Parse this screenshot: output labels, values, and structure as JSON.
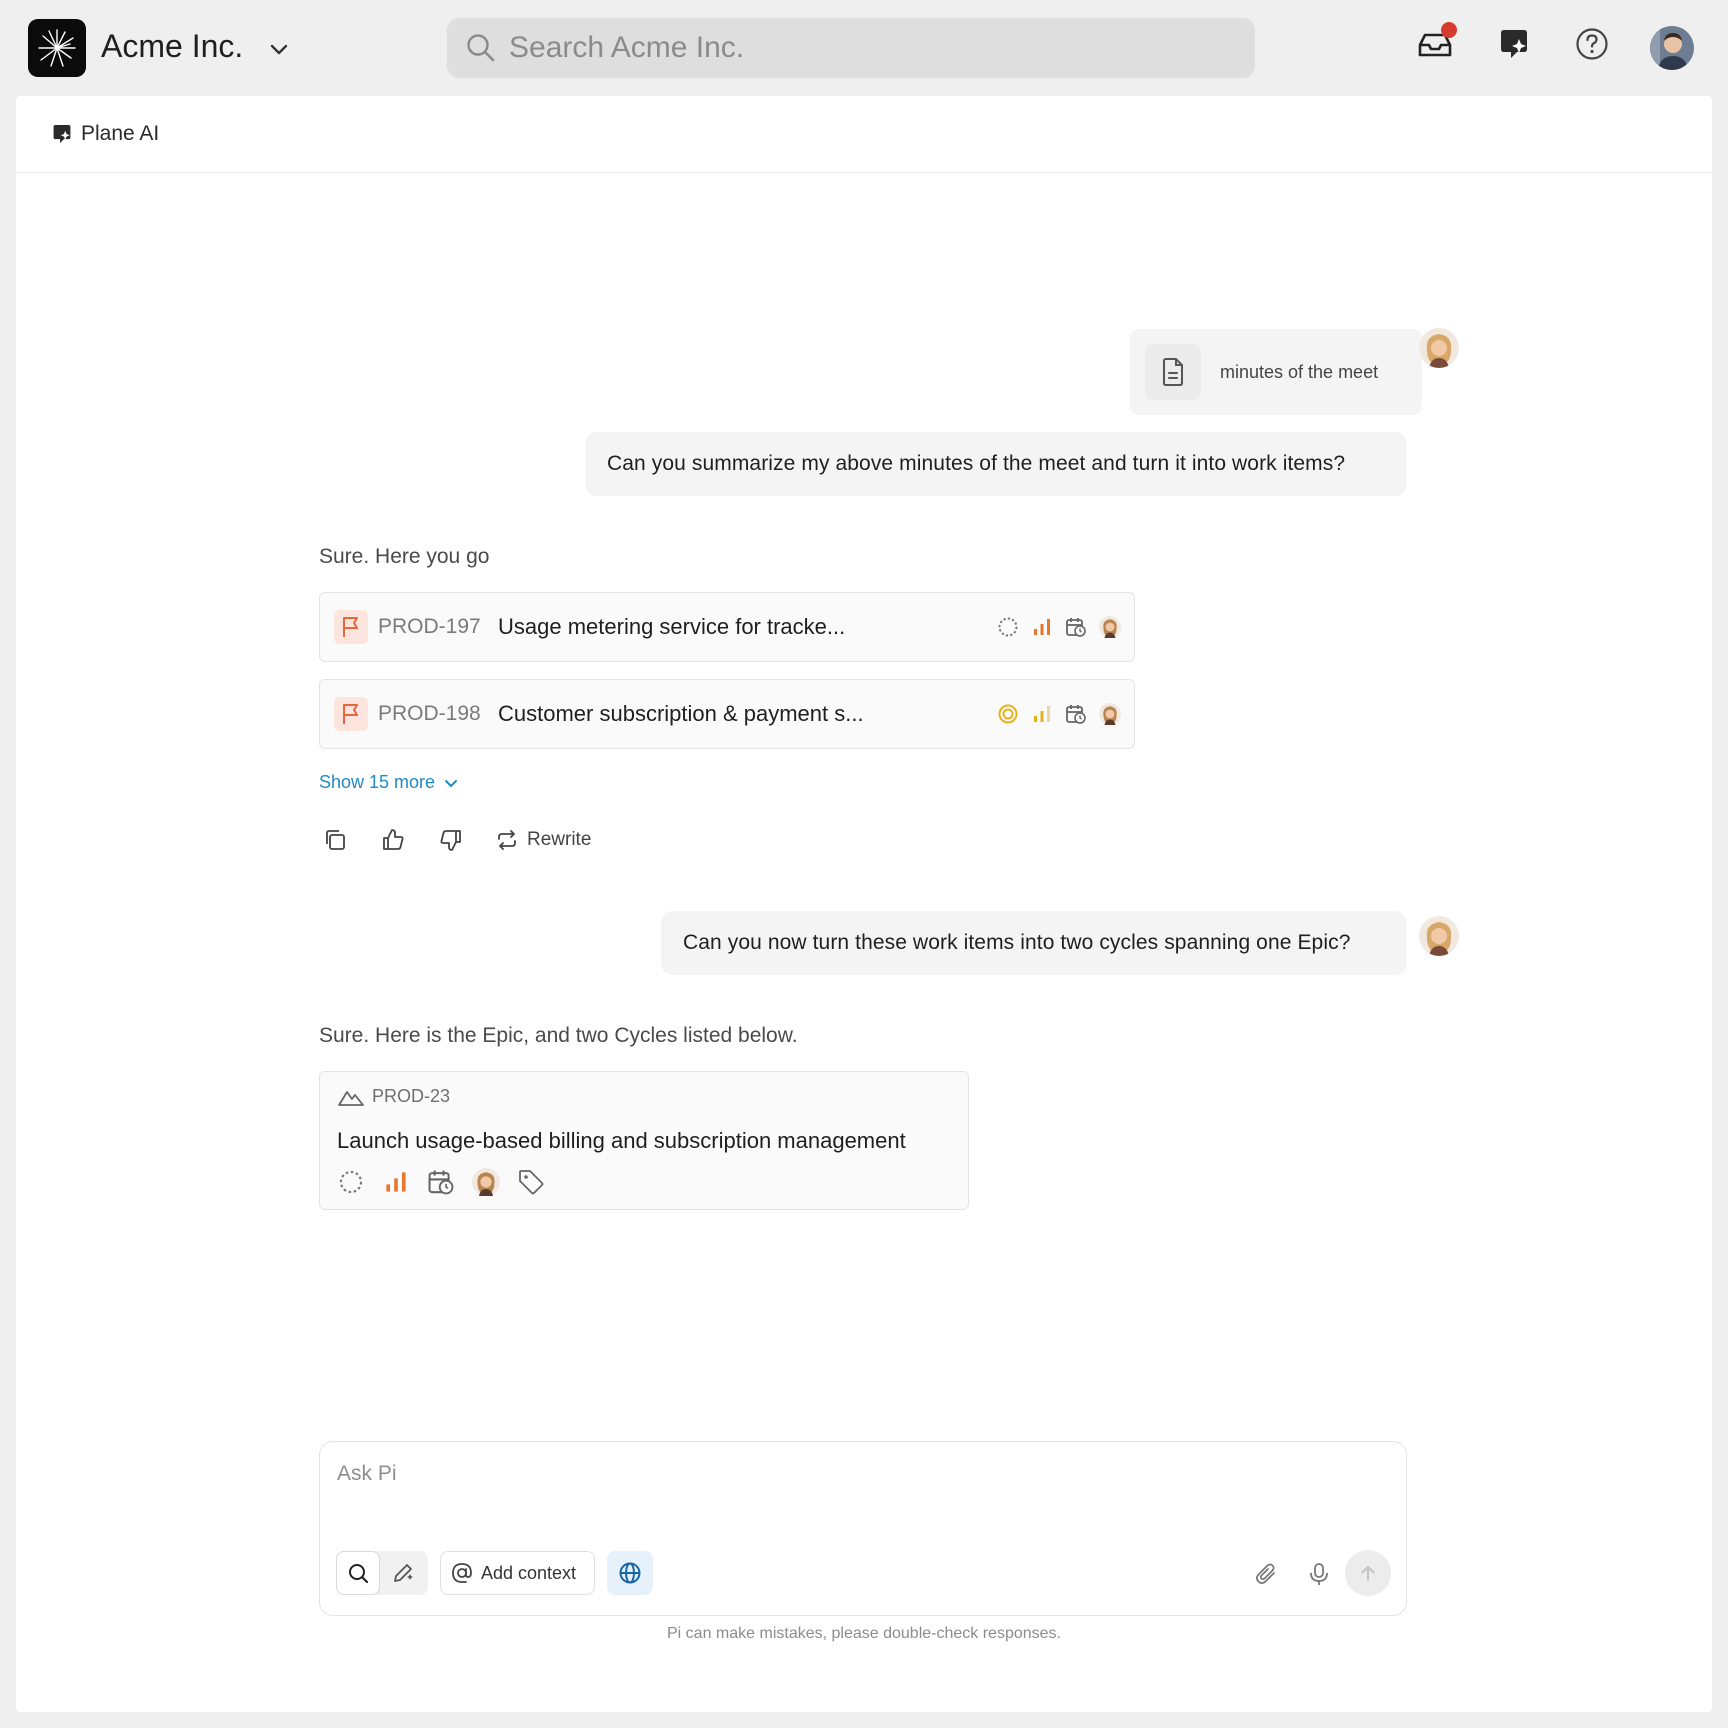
{
  "workspace": {
    "name": "Acme Inc."
  },
  "search": {
    "placeholder": "Search Acme Inc."
  },
  "page": {
    "title": "Plane AI"
  },
  "chat": {
    "attachment": {
      "name": "minutes of the meet"
    },
    "user_message_1": "Can you summarize my above minutes of the meet and turn it into work items?",
    "ai_reply_1": "Sure. Here you go",
    "work_items": [
      {
        "id": "PROD-197",
        "title": "Usage metering service for tracke...",
        "state": "backlog",
        "priority": "high"
      },
      {
        "id": "PROD-198",
        "title": "Customer subscription & payment s...",
        "state": "in-progress",
        "priority": "medium"
      }
    ],
    "show_more_label": "Show 15 more",
    "rewrite_label": "Rewrite",
    "user_message_2": "Can you now turn these work items into two cycles spanning one Epic?",
    "ai_reply_2": "Sure. Here is the Epic, and two Cycles listed below.",
    "epic": {
      "id": "PROD-23",
      "title": "Launch usage-based billing and subscription management"
    }
  },
  "composer": {
    "placeholder": "Ask Pi",
    "add_context_label": "Add context",
    "disclaimer": "Pi can make mistakes, please double-check responses."
  },
  "colors": {
    "accent_link": "#1f8bc7",
    "priority_high": "#e8762d",
    "state_in_progress": "#e5b21c",
    "notification_dot": "#d63b2f",
    "flag_bg": "#fde4dc",
    "flag_stroke": "#e5673e"
  }
}
